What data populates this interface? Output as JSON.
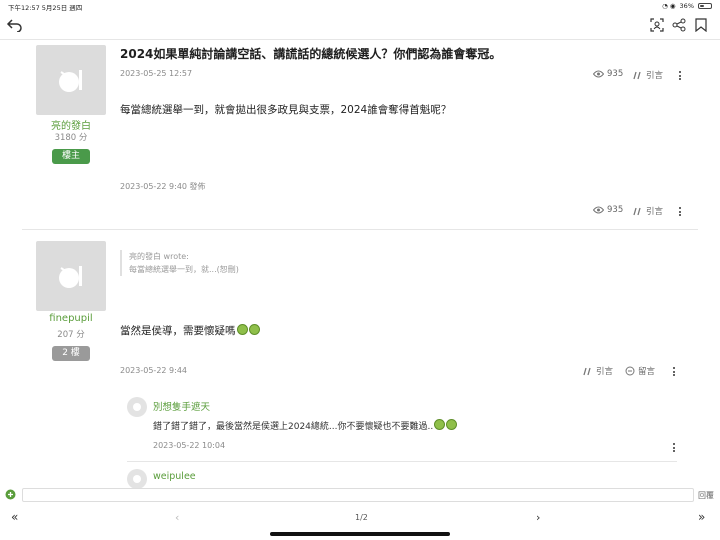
{
  "status_bar": {
    "time_date": "下午12:57  5月25日 週四",
    "battery": "36%",
    "battery_level": 0.36
  },
  "post": {
    "title": "2024如果單純討論講空話、講謊話的總統候選人？你們認為誰會奪冠。",
    "timestamp": "2023-05-25 12:57",
    "views": "935",
    "quote_label": "引言",
    "body": "每當總統選舉一到，就會拋出很多政見與支票，2024誰會奪得首魁呢？",
    "posted": "2023-05-22 9:40 發佈",
    "author": {
      "name": "亮的發白",
      "score": "3180 分",
      "badge": "樓主"
    }
  },
  "reply": {
    "author": {
      "name": "finepupil",
      "score": "207 分",
      "badge": "2 樓"
    },
    "quote_author": "亮的發白 wrote:",
    "quote_text": "每當總統選舉一到，就...(恕刪)",
    "body": "當然是侯導，需要懷疑嗎",
    "timestamp": "2023-05-22 9:44",
    "quote_label": "引言",
    "comment_label": "留言"
  },
  "comments": [
    {
      "name": "別想隻手遮天",
      "text": "錯了錯了錯了，最後當然是侯選上2024總統...你不要懷疑也不要難過..",
      "time": "2023-05-22 10:04"
    },
    {
      "name": "weipulee"
    }
  ],
  "composer": {
    "placeholder": "",
    "send_label": "回覆"
  },
  "pager": {
    "page": "1/2"
  },
  "colors": {
    "accent_green": "#5a9d3b",
    "badge_green": "#4a9a4a",
    "badge_gray": "#9a9a9a"
  }
}
